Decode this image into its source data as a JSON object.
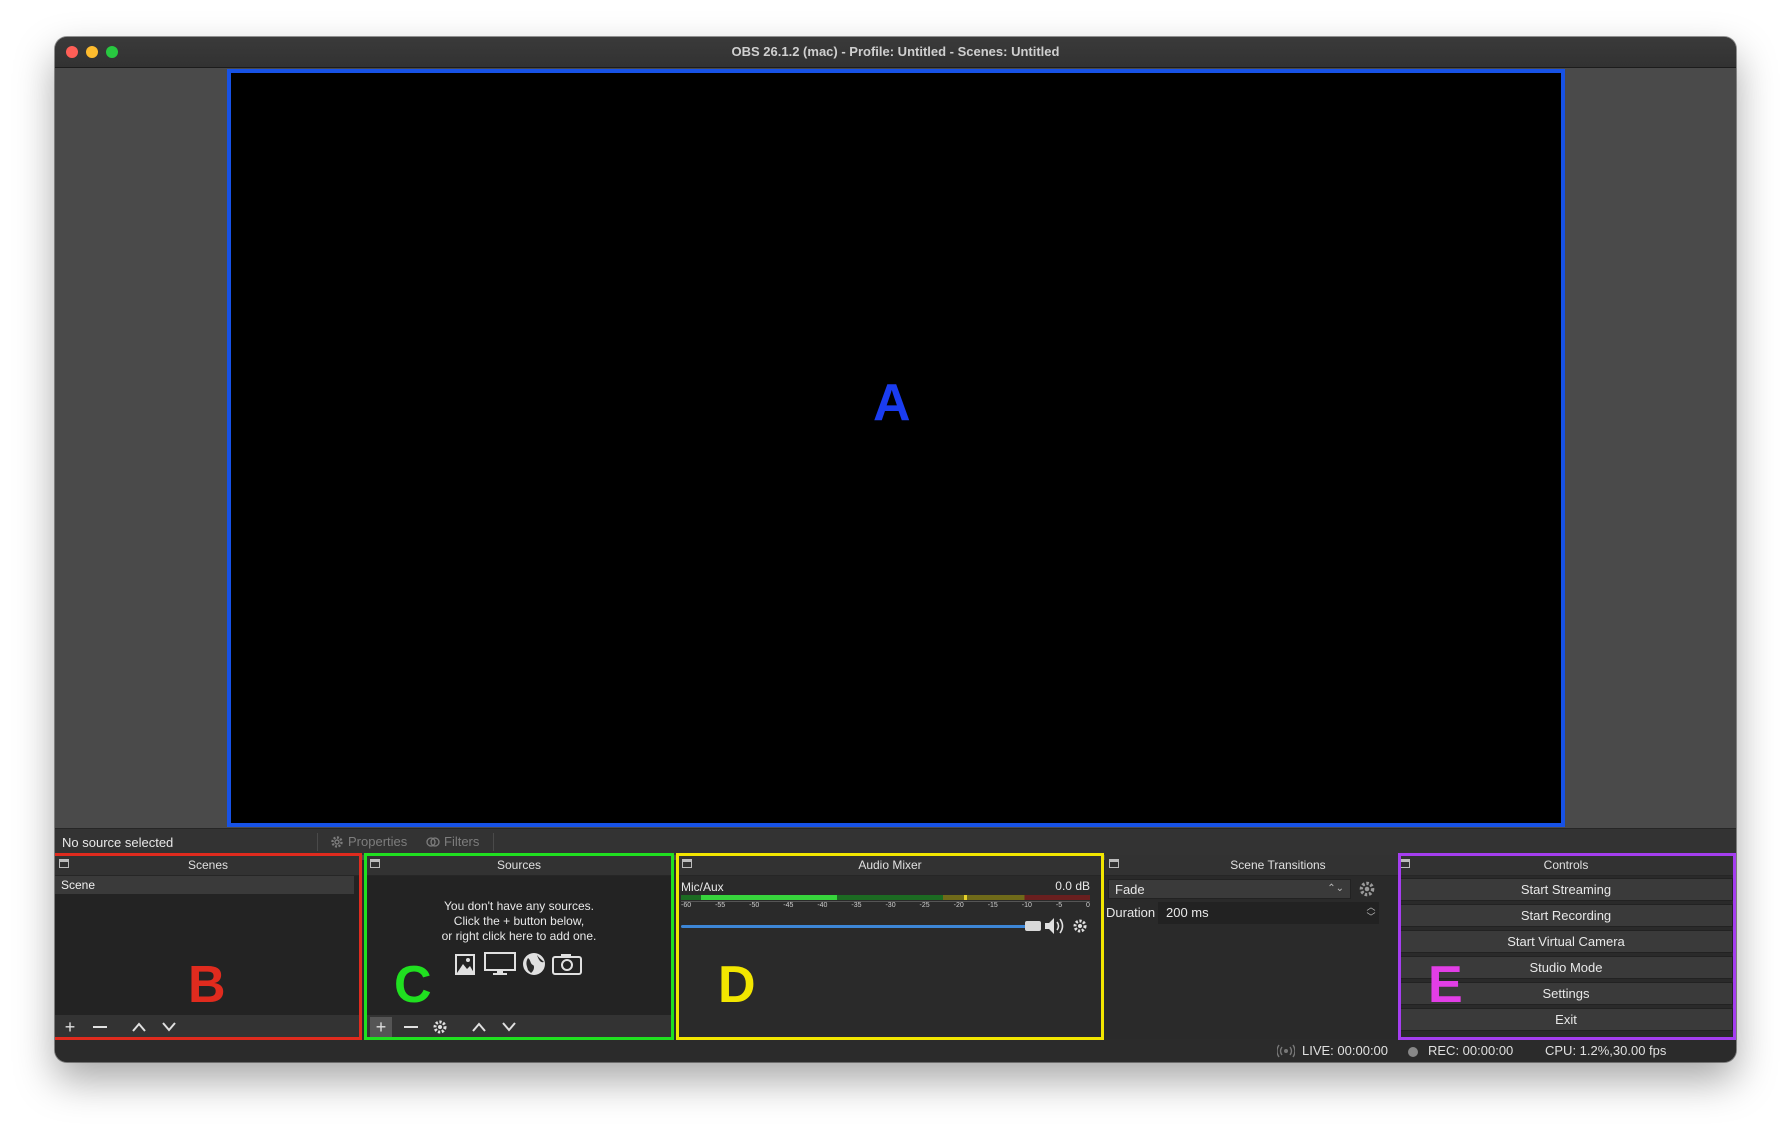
{
  "window": {
    "title": "OBS 26.1.2 (mac) - Profile: Untitled - Scenes: Untitled"
  },
  "annotations": {
    "preview": "A",
    "scenes": "B",
    "sources": "C",
    "mixer": "D",
    "controls": "E",
    "colors": {
      "A": "#1a3cf0",
      "B": "#e02b1e",
      "C": "#20e020",
      "D": "#f2e600",
      "E": "#e23ee6"
    }
  },
  "source_bar": {
    "no_source": "No source selected",
    "properties": "Properties",
    "filters": "Filters"
  },
  "scenes": {
    "title": "Scenes",
    "items": [
      "Scene"
    ]
  },
  "sources": {
    "title": "Sources",
    "empty_line1": "You don't have any sources.",
    "empty_line2": "Click the + button below,",
    "empty_line3": "or right click here to add one."
  },
  "mixer": {
    "title": "Audio Mixer",
    "channel_name": "Mic/Aux",
    "channel_db": "0.0 dB",
    "ticks": [
      "-60",
      "-55",
      "-50",
      "-45",
      "-40",
      "-35",
      "-30",
      "-25",
      "-20",
      "-15",
      "-10",
      "-5",
      "0"
    ]
  },
  "transitions": {
    "title": "Scene Transitions",
    "selected": "Fade",
    "duration_label": "Duration",
    "duration_value": "200 ms"
  },
  "controls": {
    "title": "Controls",
    "start_streaming": "Start Streaming",
    "start_recording": "Start Recording",
    "start_virtual_camera": "Start Virtual Camera",
    "studio_mode": "Studio Mode",
    "settings": "Settings",
    "exit": "Exit"
  },
  "status": {
    "live": "LIVE: 00:00:00",
    "rec": "REC: 00:00:00",
    "cpu": "CPU: 1.2%,30.00 fps"
  }
}
